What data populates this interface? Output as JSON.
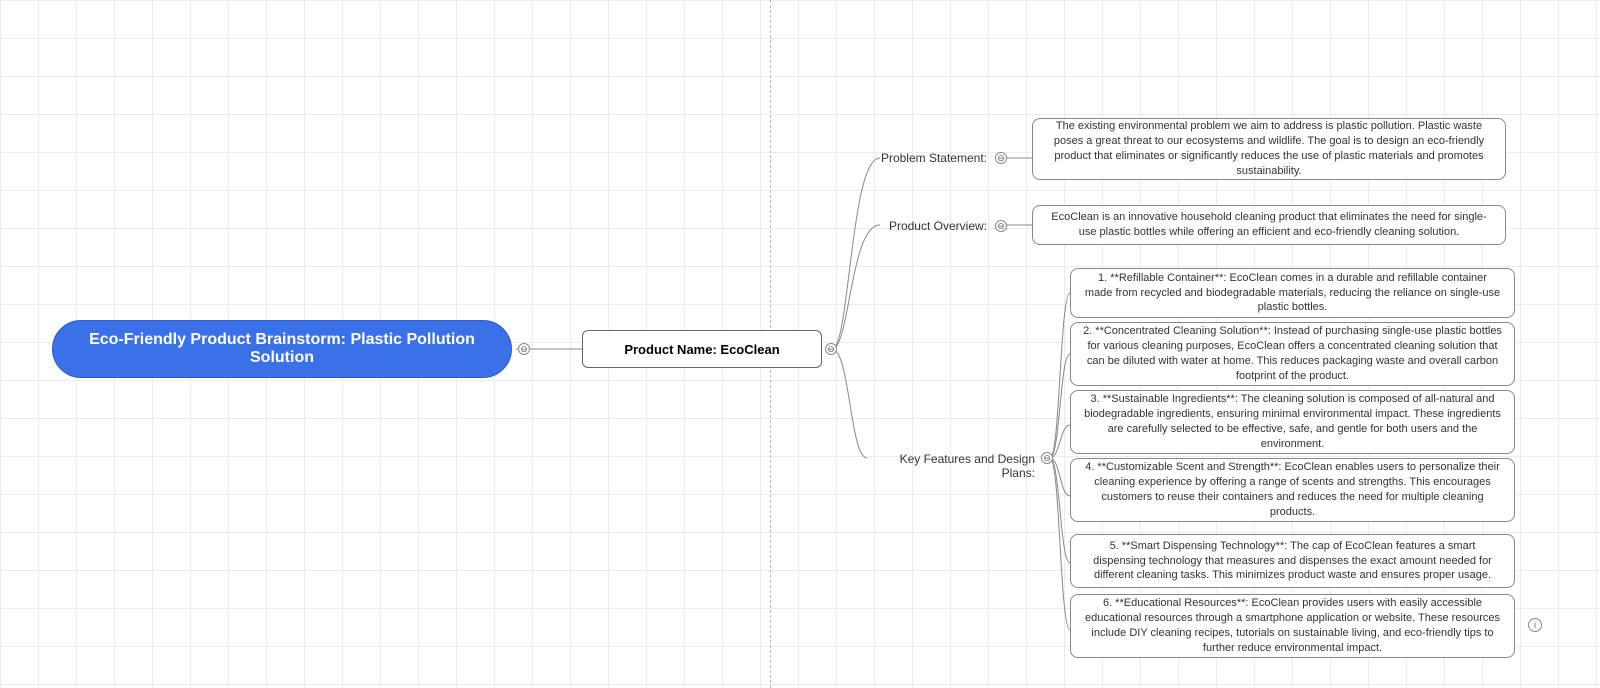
{
  "root": {
    "title": "Eco-Friendly Product Brainstorm: Plastic Pollution Solution"
  },
  "level1": {
    "title": "Product Name: EcoClean"
  },
  "branches": {
    "problem": {
      "label": "Problem Statement:",
      "content": "The existing environmental problem we aim to address is plastic pollution. Plastic waste poses a great threat to our ecosystems and wildlife. The goal is to design an eco-friendly product that eliminates or significantly reduces the use of plastic materials and promotes sustainability."
    },
    "overview": {
      "label": "Product Overview:",
      "content": "EcoClean is an innovative household cleaning product that eliminates the need for single-use plastic bottles while offering an efficient and eco-friendly cleaning solution."
    },
    "features": {
      "label": "Key Features and Design Plans:",
      "items": [
        "1. **Refillable Container**: EcoClean comes in a durable and refillable container made from recycled and biodegradable materials, reducing the reliance on single-use plastic bottles.",
        "2. **Concentrated Cleaning Solution**: Instead of purchasing single-use plastic bottles for various cleaning purposes, EcoClean offers a concentrated cleaning solution that can be diluted with water at home. This reduces packaging waste and overall carbon footprint of the product.",
        "3. **Sustainable Ingredients**: The cleaning solution is composed of all-natural and biodegradable ingredients, ensuring minimal environmental impact. These ingredients are carefully selected to be effective, safe, and gentle for both users and the environment.",
        "4. **Customizable Scent and Strength**: EcoClean enables users to personalize their cleaning experience by offering a range of scents and strengths. This encourages customers to reuse their containers and reduces the need for multiple cleaning products.",
        "5. **Smart Dispensing Technology**: The cap of EcoClean features a smart dispensing technology that measures and dispenses the exact amount needed for different cleaning tasks. This minimizes product waste and ensures proper usage.",
        "6. **Educational Resources**: EcoClean provides users with easily accessible educational resources through a smartphone application or website. These resources include DIY cleaning recipes, tutorials on sustainable living, and eco-friendly tips to further reduce environmental impact."
      ]
    }
  },
  "toggle_glyph": "⊖",
  "info_glyph": "i"
}
